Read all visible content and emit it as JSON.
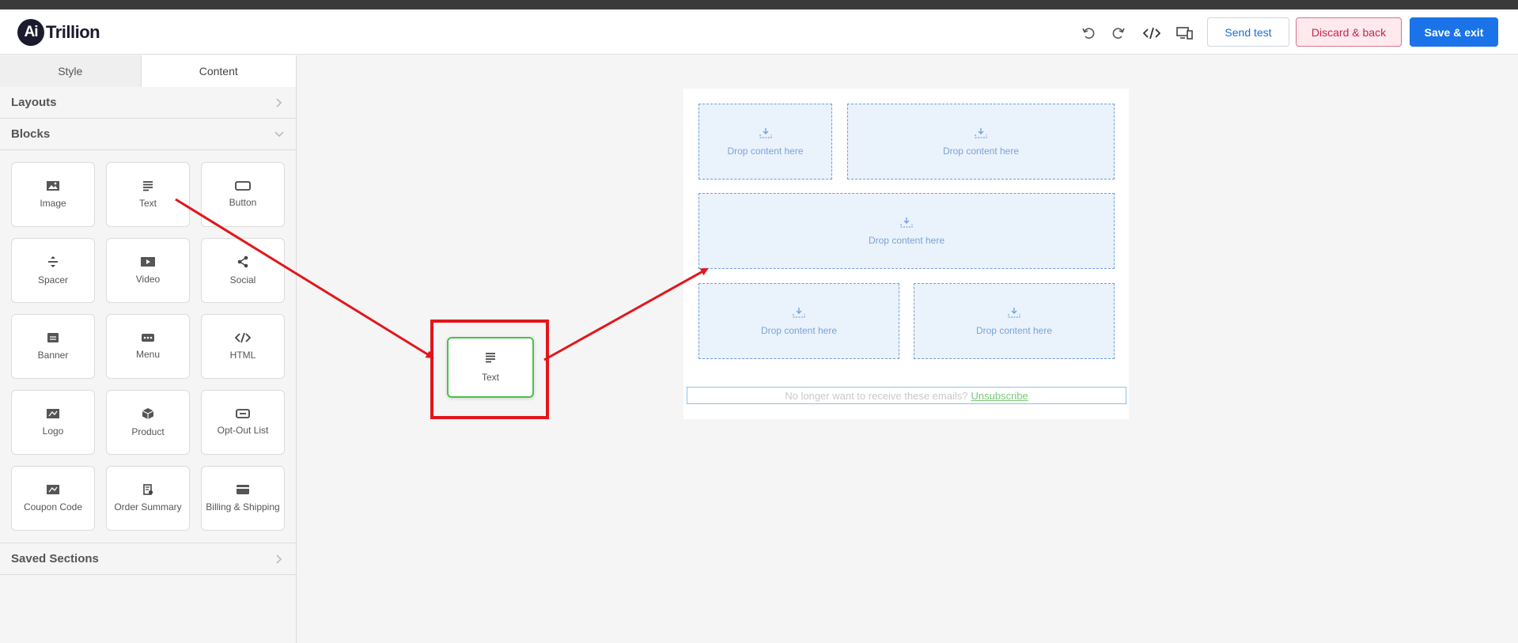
{
  "header": {
    "logo_mark": "Ai",
    "logo_name": "Trillion",
    "icons": [
      "undo-icon",
      "redo-icon",
      "code-icon",
      "responsive-preview-icon"
    ],
    "send_test_label": "Send test",
    "discard_label": "Discard & back",
    "save_label": "Save & exit"
  },
  "sidebar": {
    "tabs": [
      {
        "label": "Style",
        "active": false
      },
      {
        "label": "Content",
        "active": true
      }
    ],
    "sections": {
      "layouts": "Layouts",
      "blocks": "Blocks",
      "saved_sections": "Saved Sections"
    },
    "blocks": [
      {
        "label": "Image",
        "icon": "image-icon"
      },
      {
        "label": "Text",
        "icon": "text-icon"
      },
      {
        "label": "Button",
        "icon": "button-icon"
      },
      {
        "label": "Spacer",
        "icon": "spacer-icon"
      },
      {
        "label": "Video",
        "icon": "video-icon"
      },
      {
        "label": "Social",
        "icon": "share-icon"
      },
      {
        "label": "Banner",
        "icon": "banner-icon"
      },
      {
        "label": "Menu",
        "icon": "menu-icon"
      },
      {
        "label": "HTML",
        "icon": "code-icon"
      },
      {
        "label": "Logo",
        "icon": "logo-icon"
      },
      {
        "label": "Product",
        "icon": "box-icon"
      },
      {
        "label": "Opt-Out List",
        "icon": "optout-icon"
      },
      {
        "label": "Coupon Code",
        "icon": "coupon-icon"
      },
      {
        "label": "Order Summary",
        "icon": "receipt-icon"
      },
      {
        "label": "Billing & Shipping",
        "icon": "card-icon"
      }
    ]
  },
  "canvas": {
    "dropzone_text": "Drop content here",
    "dragging_block": {
      "label": "Text",
      "icon": "text-icon"
    },
    "footer_text": "No longer want to receive these emails?",
    "unsubscribe_label": "Unsubscribe"
  },
  "colors": {
    "primary": "#1a73e8",
    "danger": "#c8254b",
    "annotation": "#e3161b",
    "drag_border": "#47c447",
    "dropzone_fill": "#eaf2fc"
  }
}
